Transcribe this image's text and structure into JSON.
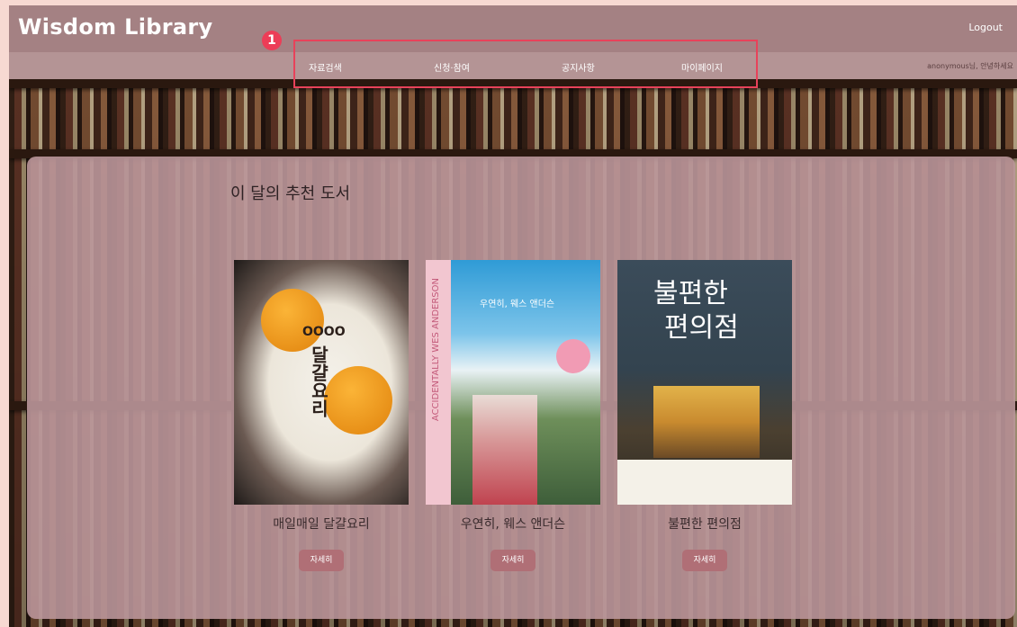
{
  "header": {
    "logo": "Wisdom Library",
    "logout": "Logout"
  },
  "nav": {
    "items": [
      "자료검색",
      "신청·참여",
      "공지사항",
      "마이페이지"
    ],
    "user_info": "anonymous님, 안녕하세요"
  },
  "annotation": {
    "badge": "1"
  },
  "main": {
    "section_title": "이 달의 추천 도서",
    "books": [
      {
        "title": "매일매일 달걀요리",
        "button": "자세히",
        "cover_title": "달걀요리",
        "cover_eggs": "OOOO"
      },
      {
        "title": "우연히, 웨스 앤더슨",
        "button": "자세히",
        "cover_title": "우연히, 웨스 앤더슨",
        "cover_spine": "ACCIDENTALLY WES ANDERSON"
      },
      {
        "title": "불편한 편의점",
        "button": "자세히",
        "cover_title_line1": "불편한",
        "cover_title_line2": "편의점"
      }
    ]
  },
  "colors": {
    "header": "#a48183",
    "navbar": "#b49495",
    "panel": "#ba969a",
    "button": "#b06f76",
    "highlight": "#e8425a"
  }
}
